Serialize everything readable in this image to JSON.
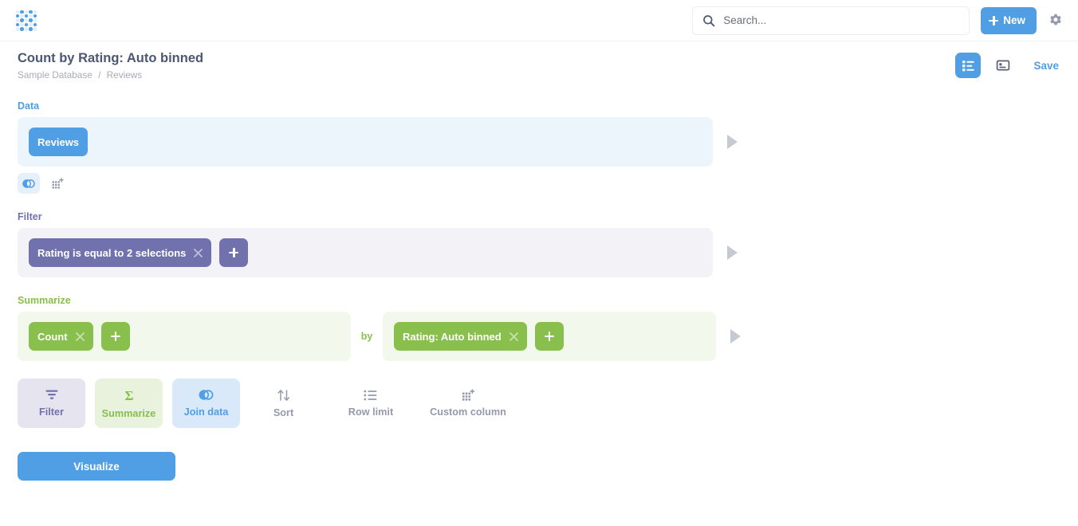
{
  "app": {
    "logo_icon": "metabase-logo-dots"
  },
  "topnav": {
    "search": {
      "placeholder": "Search...",
      "value": "",
      "icon": "search-icon"
    },
    "new_button": {
      "label": "New",
      "icon": "plus-icon"
    },
    "settings": {
      "icon": "gear-icon"
    }
  },
  "header": {
    "title": "Count by Rating: Auto binned",
    "breadcrumb": {
      "database": "Sample Database",
      "separator": "/",
      "table": "Reviews"
    },
    "notebook_toggle": {
      "icon": "notebook-editor-icon",
      "active": true
    },
    "visualization_toggle": {
      "icon": "visualization-icon",
      "active": false
    },
    "save_label": "Save"
  },
  "notebook": {
    "data": {
      "label": "Data",
      "accent": "#509ee3",
      "source": "Reviews",
      "preview_icon": "play-triangle-icon",
      "sub_actions": [
        {
          "name": "join-data",
          "icon": "join-circles-icon",
          "active": true
        },
        {
          "name": "custom-column",
          "icon": "custom-column-icon",
          "active": false
        }
      ]
    },
    "filter": {
      "label": "Filter",
      "accent": "#7172ad",
      "clauses": [
        "Rating is equal to 2 selections"
      ],
      "add_label": "+",
      "remove_icon": "close-icon",
      "preview_icon": "play-triangle-icon"
    },
    "summarize": {
      "label": "Summarize",
      "accent": "#88bf4d",
      "by_word": "by",
      "aggregations": [
        "Count"
      ],
      "breakouts": [
        "Rating: Auto binned"
      ],
      "add_label": "+",
      "remove_icon": "close-icon",
      "preview_icon": "play-triangle-icon"
    }
  },
  "action_buttons": [
    {
      "label": "Filter",
      "icon": "funnel-icon",
      "style": "filter"
    },
    {
      "label": "Summarize",
      "icon": "sigma-icon",
      "style": "summarize"
    },
    {
      "label": "Join data",
      "icon": "join-circles-icon",
      "style": "join"
    },
    {
      "label": "Sort",
      "icon": "sort-arrows-icon",
      "style": "plain"
    },
    {
      "label": "Row limit",
      "icon": "list-icon",
      "style": "plain"
    },
    {
      "label": "Custom column",
      "icon": "custom-column-icon",
      "style": "plain"
    }
  ],
  "visualize_button": {
    "label": "Visualize"
  }
}
